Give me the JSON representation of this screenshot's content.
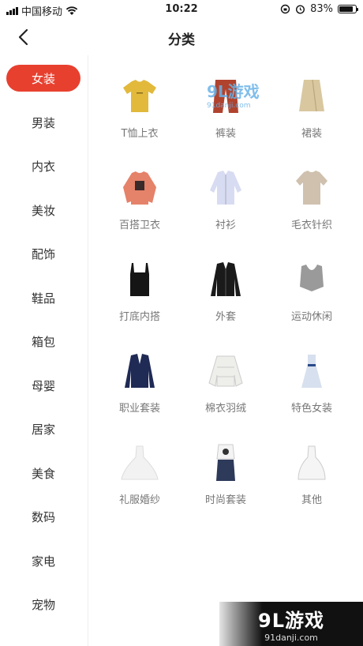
{
  "status_bar": {
    "carrier": "中国移动",
    "time": "10:22",
    "battery": "83%"
  },
  "nav": {
    "title": "分类"
  },
  "sidebar": {
    "items": [
      {
        "label": "女装",
        "active": true
      },
      {
        "label": "男装"
      },
      {
        "label": "内衣"
      },
      {
        "label": "美妆"
      },
      {
        "label": "配饰"
      },
      {
        "label": "鞋品"
      },
      {
        "label": "箱包"
      },
      {
        "label": "母婴"
      },
      {
        "label": "居家"
      },
      {
        "label": "美食"
      },
      {
        "label": "数码"
      },
      {
        "label": "家电"
      },
      {
        "label": "宠物"
      }
    ]
  },
  "categories": [
    {
      "label": "T恤上衣",
      "icon": "tshirt-icon"
    },
    {
      "label": "裤装",
      "icon": "pants-icon"
    },
    {
      "label": "裙装",
      "icon": "skirt-icon"
    },
    {
      "label": "百搭卫衣",
      "icon": "sweatshirt-icon"
    },
    {
      "label": "衬衫",
      "icon": "shirt-icon"
    },
    {
      "label": "毛衣针织",
      "icon": "sweater-icon"
    },
    {
      "label": "打底内搭",
      "icon": "camisole-icon"
    },
    {
      "label": "外套",
      "icon": "jacket-icon"
    },
    {
      "label": "运动休闲",
      "icon": "sports-bra-icon"
    },
    {
      "label": "职业套装",
      "icon": "blazer-icon"
    },
    {
      "label": "棉衣羽绒",
      "icon": "down-jacket-icon"
    },
    {
      "label": "特色女装",
      "icon": "dress-icon"
    },
    {
      "label": "礼服婚纱",
      "icon": "wedding-dress-icon"
    },
    {
      "label": "时尚套装",
      "icon": "outfit-icon"
    },
    {
      "label": "其他",
      "icon": "gown-icon"
    }
  ],
  "watermark": {
    "logo": "9L游戏",
    "url": "91danji.com",
    "mid_logo": "9L游戏",
    "mid_url": "91danji.com"
  },
  "colors": {
    "accent": "#e8402f"
  }
}
